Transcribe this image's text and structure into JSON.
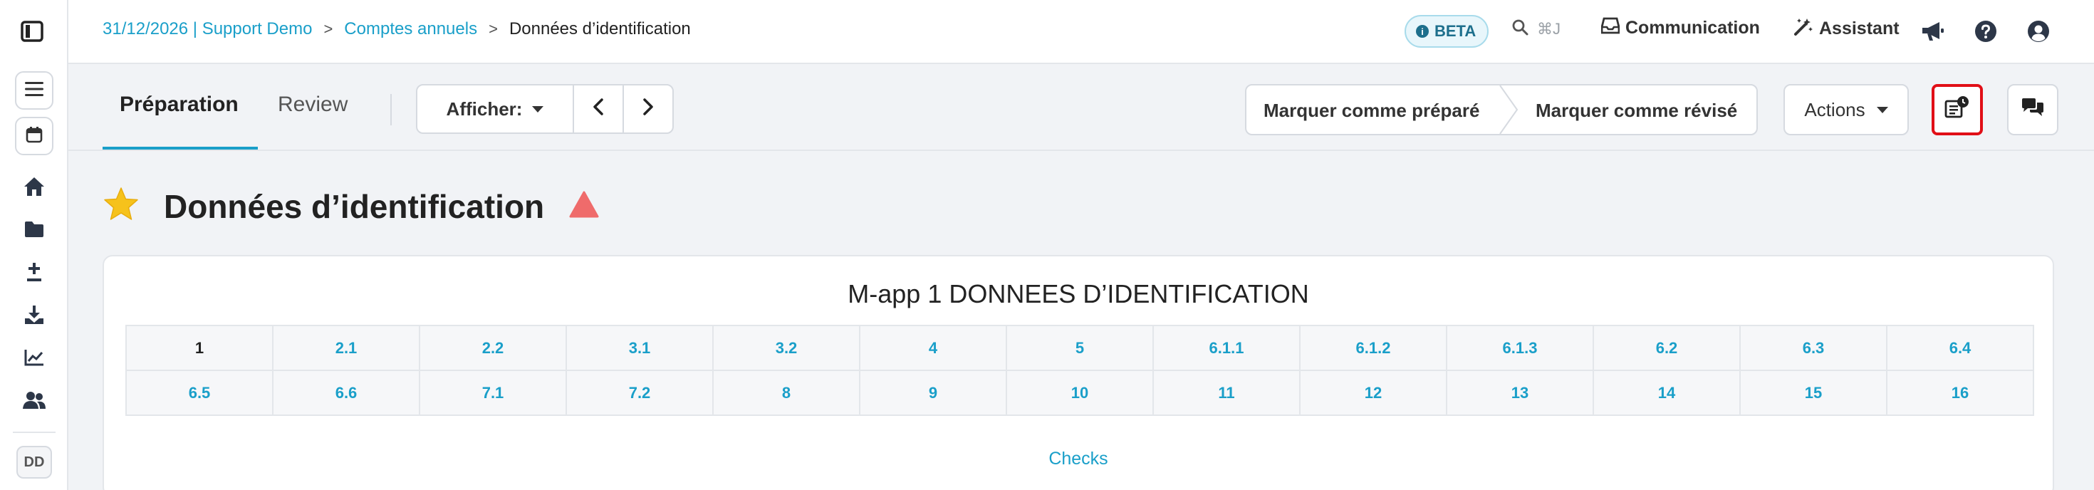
{
  "breadcrumb": {
    "item1": "31/12/2026 | Support Demo",
    "item2": "Comptes annuels",
    "current": "Données d’identification",
    "separator": ">"
  },
  "topbar": {
    "beta_label": "BETA",
    "beta_icon": "info-icon",
    "search_shortcut": "⌘J",
    "communication_label": "Communication",
    "assistant_label": "Assistant"
  },
  "tabs": {
    "preparation": "Préparation",
    "review": "Review"
  },
  "toolbar": {
    "afficher_label": "Afficher:",
    "mark_prepared": "Marquer comme préparé",
    "mark_reviewed": "Marquer comme révisé",
    "actions_label": "Actions"
  },
  "page": {
    "title": "Données d’identification"
  },
  "card": {
    "title": "M-app 1 DONNEES D’IDENTIFICATION",
    "rows": [
      [
        "1",
        "2.1",
        "2.2",
        "3.1",
        "3.2",
        "4",
        "5",
        "6.1.1",
        "6.1.2",
        "6.1.3",
        "6.2",
        "6.3",
        "6.4"
      ],
      [
        "6.5",
        "6.6",
        "7.1",
        "7.2",
        "8",
        "9",
        "10",
        "11",
        "12",
        "13",
        "14",
        "15",
        "16"
      ]
    ],
    "active_section": "1",
    "checks_label": "Checks"
  },
  "sidebar": {
    "avatar_initials": "DD",
    "icons": [
      "menu-icon",
      "calendar-icon",
      "home-icon",
      "folder-icon",
      "plus-minus-icon",
      "download-icon",
      "chart-icon",
      "users-icon"
    ]
  },
  "colors": {
    "accent": "#1a9fc9",
    "highlight_border": "#e10f17",
    "star": "#f6c21b",
    "warning": "#ef6b6b"
  }
}
